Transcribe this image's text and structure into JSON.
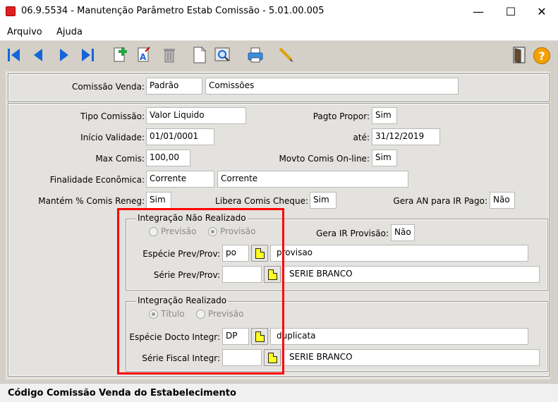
{
  "window": {
    "title": "06.9.5534 - Manutenção Parâmetro Estab Comissão - 5.01.00.005",
    "minimize": "—",
    "maximize": "☐",
    "close": "✕"
  },
  "menu": {
    "items": [
      "Arquivo",
      "Ajuda"
    ]
  },
  "toolbar": {
    "buttons": [
      "first-icon",
      "previous-icon",
      "next-icon",
      "last-icon",
      "new-icon",
      "edit-icon",
      "delete-icon",
      "blank-doc-icon",
      "zoom-icon",
      "print-icon",
      "pencil-icon",
      "exit-door-icon",
      "help-icon"
    ],
    "help_label": "?"
  },
  "header": {
    "comissao_venda_label": "Comissão Venda:",
    "comissao_venda_value": "Padrão",
    "comissao_venda_desc": "Comissões"
  },
  "form": {
    "tipo_comissao_label": "Tipo Comissão:",
    "tipo_comissao_value": "Valor Liquido",
    "pagto_propor_label": "Pagto Propor:",
    "pagto_propor_value": "Sim",
    "inicio_validade_label": "Início Validade:",
    "inicio_validade_value": "01/01/0001",
    "ate_label": "até:",
    "ate_value": "31/12/2019",
    "max_comis_label": "Max Comis:",
    "max_comis_value": "100,00",
    "movto_online_label": "Movto Comis On-line:",
    "movto_online_value": "Sim",
    "finalidade_label": "Finalidade Econômica:",
    "finalidade_value": "Corrente",
    "finalidade_desc": "Corrente",
    "mantem_label": "Mantém % Comis Reneg:",
    "mantem_value": "Sim",
    "libera_label": "Libera Comis Cheque:",
    "libera_value": "Sim",
    "gera_an_label": "Gera AN para IR Pago:",
    "gera_an_value": "Não"
  },
  "nao_realizado": {
    "legend": "Integração Não Realizado",
    "radio_1": "Previsão",
    "radio_2": "Provisão",
    "selected": "Provisão",
    "gera_ir_label": "Gera IR Provisão:",
    "gera_ir_value": "Não",
    "especie_label": "Espécie Prev/Prov:",
    "especie_value": "po",
    "especie_desc": "provisao",
    "serie_label": "Série Prev/Prov:",
    "serie_value": "",
    "serie_desc": "SERIE BRANCO"
  },
  "realizado": {
    "legend": "Integração Realizado",
    "radio_1": "Título",
    "radio_2": "Previsão",
    "selected": "Título",
    "especie_label": "Espécie Docto Integr:",
    "especie_value": "DP",
    "especie_desc": "duplicata",
    "serie_label": "Série Fiscal Integr:",
    "serie_value": "",
    "serie_desc": "SERIE BRANCO"
  },
  "status": {
    "text": "Código Comissão Venda do Estabelecimento"
  },
  "colors": {
    "highlight": "#ff0000",
    "doc_yellow": "#ffff20",
    "nav_blue": "#1565d8",
    "help_orange": "#f5a000"
  }
}
